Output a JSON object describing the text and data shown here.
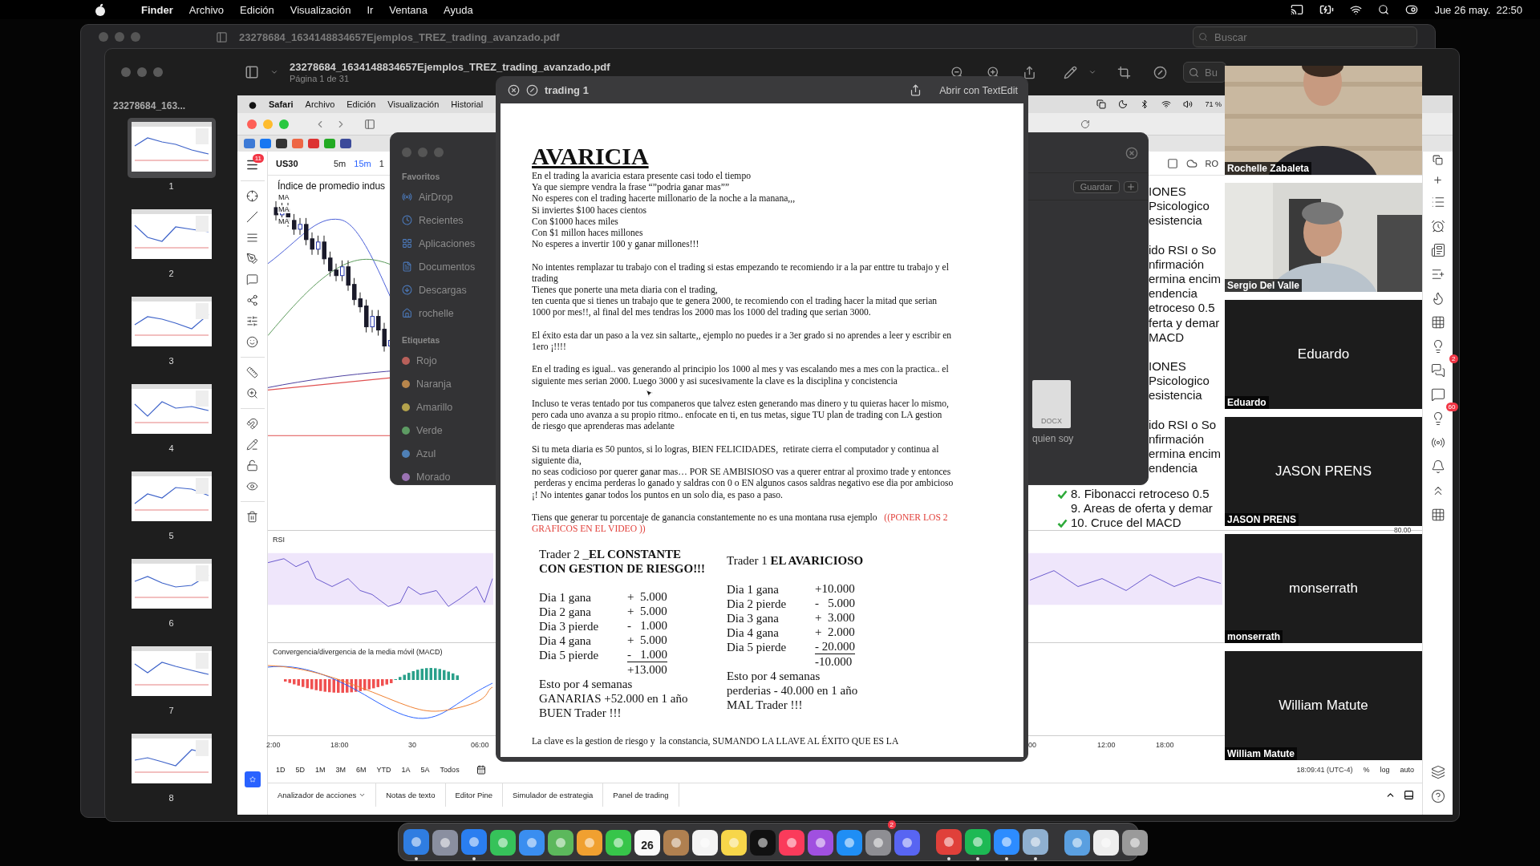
{
  "menubar": {
    "app": "Finder",
    "menus": [
      "Archivo",
      "Edición",
      "Visualización",
      "Ir",
      "Ventana",
      "Ayuda"
    ],
    "clock": "Jue 26 may.  22:50"
  },
  "back_window": {
    "title": "23278684_1634148834657Ejemplos_TREZ_trading_avanzado.pdf",
    "search_placeholder": "Buscar"
  },
  "preview": {
    "title": "23278684_1634148834657Ejemplos_TREZ_trading_avanzado.pdf",
    "subtitle": "Página 1 de 31",
    "search_placeholder": "Bu",
    "sidebar_title": "23278684_163...",
    "thumbnails": [
      {
        "label": "1",
        "selected": true
      },
      {
        "label": "2",
        "selected": false
      },
      {
        "label": "3",
        "selected": false
      },
      {
        "label": "4",
        "selected": false
      },
      {
        "label": "5",
        "selected": false
      },
      {
        "label": "6",
        "selected": false
      },
      {
        "label": "7",
        "selected": false
      },
      {
        "label": "8",
        "selected": false
      }
    ]
  },
  "page": {
    "safari_menus": [
      "Safari",
      "Archivo",
      "Edición",
      "Visualización",
      "Historial"
    ],
    "battery": "71 %",
    "menu_badge": "11",
    "symbol": "US30",
    "intervals": [
      {
        "label": "5m",
        "selected": false
      },
      {
        "label": "15m",
        "selected": true
      },
      {
        "label": "1",
        "selected": false
      }
    ],
    "layout_name": "RO",
    "chart_title": "Índice de promedio indus",
    "ma_labels": [
      "MA",
      "MA",
      "MA"
    ],
    "rsi_label": "RSI",
    "macd_label": "Convergencia/divergencia de la media móvil (MACD)",
    "time_labels": [
      "2:00",
      "18:00",
      "30",
      "06:00",
      "00",
      "12:00",
      "18:00"
    ],
    "ranges": [
      "1D",
      "5D",
      "1M",
      "3M",
      "6M",
      "YTD",
      "1A",
      "5A",
      "Todos"
    ],
    "clock": "18:09:41 (UTC-4)",
    "scale_options": [
      "%",
      "log",
      "auto"
    ],
    "price_label": "80.00",
    "bottom_tabs": [
      "Analizador de acciones",
      "Notas de texto",
      "Editor Pine",
      "Simulador de estrategia",
      "Panel de trading"
    ],
    "note_groups": [
      [
        "IONES",
        "Psicologico",
        "esistencia"
      ],
      [
        "ido RSI o So",
        "nfirmación",
        "ermina encim",
        "endencia",
        "etroceso 0.5",
        "ferta y demar",
        "MACD"
      ],
      [
        "IONES",
        "Psicologico",
        "esistencia"
      ],
      [
        "ido RSI o So",
        "nfirmación",
        "ermina encim",
        "endencia"
      ]
    ],
    "checklist": [
      {
        "text": "8. Fibonacci retroceso 0.5",
        "checked": true
      },
      {
        "text": "9. Areas de oferta y demar",
        "checked": false
      },
      {
        "text": "10. Cruce del MACD",
        "checked": true
      }
    ]
  },
  "finder": {
    "favorites_title": "Favoritos",
    "favorites": [
      "AirDrop",
      "Recientes",
      "Aplicaciones",
      "Documentos",
      "Descargas",
      "rochelle"
    ],
    "tags_title": "Etiquetas",
    "tags": [
      {
        "name": "Rojo",
        "color": "#b8605a"
      },
      {
        "name": "Naranja",
        "color": "#b8864c"
      },
      {
        "name": "Amarillo",
        "color": "#b3a24c"
      },
      {
        "name": "Verde",
        "color": "#5d9b63"
      },
      {
        "name": "Azul",
        "color": "#4f80b6"
      },
      {
        "name": "Morado",
        "color": "#9a72b2"
      }
    ],
    "save_button": "Guardar",
    "file": {
      "name": "quien soy",
      "type": "DOCX"
    }
  },
  "quicklook": {
    "title": "trading 1",
    "open_button": "Abrir con TextEdit",
    "document": {
      "heading": "AVARICIA",
      "paragraphs": [
        {
          "kind": "plain",
          "lines": [
            "En el trading la avaricia estara presente casi todo el tiempo",
            "Ya que siempre vendra la frase “”podria ganar mas””",
            "No esperes con el trading hacerte millonario de la noche a la manana,,,",
            "Si inviertes $100 haces cientos",
            "Con $1000 haces miles",
            "Con $1 millon haces millones",
            "No esperes a invertir 100 y ganar millones!!!"
          ]
        },
        {
          "kind": "plain",
          "lines": [
            "No intentes remplazar tu trabajo con el trading si estas empezando te recomiendo ir a la par enttre tu trabajo y el",
            "trading",
            "Tienes que ponerte una meta diaria con el trading,",
            "ten cuenta que si tienes un trabajo que te genera 2000, te recomiendo con el trading hacer la mitad que serian",
            "1000 por mes!!, al final del mes tendras los 2000 mas los 1000 del trading que serian 3000."
          ]
        },
        {
          "kind": "plain",
          "lines": [
            "El éxito esta dar un paso a la vez sin saltarte,, ejemplo no puedes ir a 3er grado si no aprendes a leer y escribir en",
            "1ero ¡!!!!"
          ]
        },
        {
          "kind": "plain",
          "lines": [
            "En el trading es igual.. vas generando al principio los 1000 al mes y vas escalando mes a mes con la practica.. el",
            "siguiente mes serian 2000. Luego 3000 y asi sucesivamente la clave es la disciplina y concistencia"
          ]
        },
        {
          "kind": "plain",
          "lines": [
            "Incluso te veras tentado por tus companeros que talvez esten generando mas dinero y tu quieras hacer lo mismo,",
            "pero cada uno avanza a su propio ritmo.. enfocate en ti, en tus metas, sigue TU plan de trading con LA gestion",
            "de riesgo que aprenderas mas adelante"
          ]
        },
        {
          "kind": "plain",
          "lines": [
            "Si tu meta diaria es 50 puntos, si lo logras, BIEN FELICIDADES,  retirate cierra el computador y continua al",
            "siguiente dia,",
            "no seas codicioso por querer ganar mas… POR SE AMBISIOSO vas a querer entrar al proximo trade y entonces",
            " perderas y encima perderas lo ganado y saldras con 0 o EN algunos casos saldras negativo ese dia por ambicioso",
            "¡! No intentes ganar todos los puntos en un solo dia, es paso a paso."
          ]
        },
        {
          "kind": "mixed",
          "lines": [
            [
              {
                "text": "Tiens que generar tu porcentaje de ganancia constantemente no es una montana rusa ejemplo   ",
                "alert": false
              },
              {
                "text": "((PONER LOS 2",
                "alert": true
              }
            ],
            [
              {
                "text": "GRAFICOS EN EL VIDEO ))",
                "alert": true
              }
            ]
          ]
        }
      ],
      "traders": [
        {
          "heading": [
            "Trader 2 _**EL CONSTANTE**",
            "**CON GESTION DE RIESGO!!!**"
          ],
          "rows": [
            {
              "label": "Dia 1 gana",
              "amount": "+  5.000",
              "underlined": false
            },
            {
              "label": "Dia 2 gana",
              "amount": "+  5.000",
              "underlined": false
            },
            {
              "label": "Dia 3 pierde",
              "amount": "-   1.000",
              "underlined": false
            },
            {
              "label": "Dia 4 gana",
              "amount": "+  5.000",
              "underlined": false
            },
            {
              "label": "Dia 5 pierde",
              "amount": "-   1.000",
              "underlined": true
            }
          ],
          "total": "+13.000",
          "summary": [
            "Esto por 4 semanas",
            "GANARIAS +52.000 en 1 año",
            "BUEN Trader !!!"
          ]
        },
        {
          "heading": [
            "Trader 1 **EL AVARICIOSO**"
          ],
          "rows": [
            {
              "label": "Dia 1 gana",
              "amount": "+10.000",
              "underlined": false
            },
            {
              "label": "Dia 2 pierde",
              "amount": "-   5.000",
              "underlined": false
            },
            {
              "label": "Dia 3 gana",
              "amount": "+  3.000",
              "underlined": false
            },
            {
              "label": "Dia 4 gana",
              "amount": "+  2.000",
              "underlined": false
            },
            {
              "label": "Dia 5 pierde",
              "amount": "- 20.000",
              "underlined": true
            }
          ],
          "total": "-10.000",
          "summary": [
            "Esto por 4 semanas",
            "perderias - 40.000 en 1 año",
            "MAL Trader !!!"
          ]
        }
      ],
      "closing": "La clave es la gestion de riesgo y  la constancia, SUMANDO LA LLAVE AL ÉXITO QUE ES LA"
    }
  },
  "participants": [
    {
      "kind": "video",
      "name": "Rochelle Zabaleta"
    },
    {
      "kind": "video",
      "name": "Sergio Del Valle"
    },
    {
      "kind": "avatar",
      "display_name": "Eduardo",
      "name": "Eduardo"
    },
    {
      "kind": "avatar",
      "display_name": "JASON PRENS",
      "name": "JASON PRENS"
    },
    {
      "kind": "avatar",
      "display_name": "monserrath",
      "name": "monserrath"
    },
    {
      "kind": "avatar",
      "display_name": "William Matute",
      "name": "William Matute"
    }
  ],
  "side_badges": {
    "chats": "2",
    "ideas": "60"
  },
  "dock": [
    {
      "running": true
    },
    {
      "running": false
    },
    {
      "running": true
    },
    {
      "running": false
    },
    {
      "running": false
    },
    {
      "running": false
    },
    {
      "running": false
    },
    {
      "running": false
    },
    {
      "running": false,
      "label": "26"
    },
    {
      "running": false
    },
    {
      "running": false
    },
    {
      "running": false
    },
    {
      "running": false
    },
    {
      "running": false
    },
    {
      "running": false
    },
    {
      "running": false
    },
    {
      "running": false,
      "badge": "2"
    },
    {
      "running": false
    },
    {
      "running": true
    },
    {
      "running": true
    },
    {
      "running": true
    },
    {
      "running": true
    },
    {
      "running": false
    },
    {
      "running": false
    },
    {
      "running": false
    }
  ]
}
